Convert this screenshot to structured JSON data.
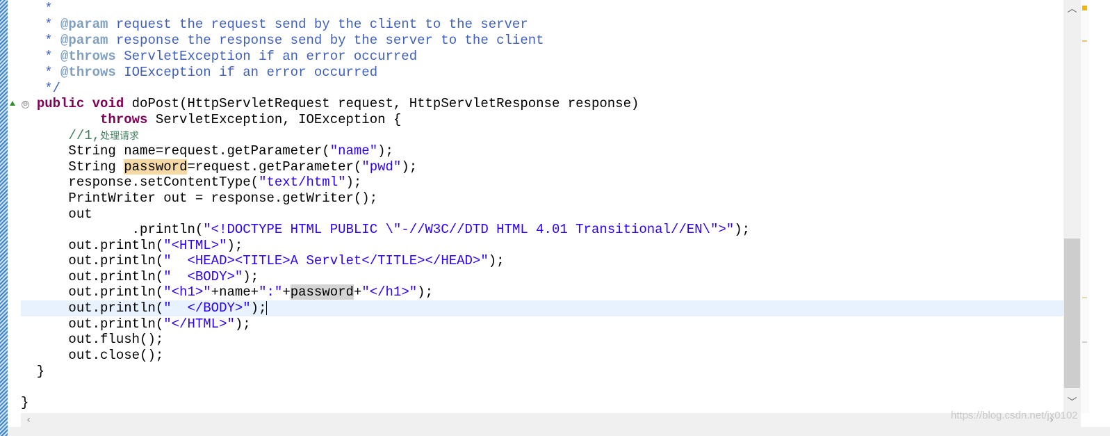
{
  "editor": {
    "lines": {
      "l1": {
        "text": "   *"
      },
      "l2": {
        "pre": "   * ",
        "tag": "@param",
        "post": " request the request send by the client to the server"
      },
      "l3": {
        "pre": "   * ",
        "tag": "@param",
        "post": " response the response send by the server to the client"
      },
      "l4": {
        "pre": "   * ",
        "tag": "@throws",
        "post": " ServletException if an error occurred"
      },
      "l5": {
        "pre": "   * ",
        "tag": "@throws",
        "post": " IOException if an error occurred"
      },
      "l6": {
        "text": "   */"
      },
      "l7": {
        "indent": "  ",
        "kw1": "public",
        "sp1": " ",
        "kw2": "void",
        "rest": " doPost(HttpServletRequest request, HttpServletResponse response)"
      },
      "l8": {
        "indent": "          ",
        "kw": "throws",
        "rest": " ServletException, IOException {"
      },
      "l9": {
        "indent": "      ",
        "prefix": "//1,",
        "cjk": "处理请求"
      },
      "l10": {
        "indent": "      ",
        "a": "String name=request.getParameter(",
        "s": "\"name\"",
        "b": ");"
      },
      "l11": {
        "indent": "      ",
        "a": "String ",
        "occ": "password",
        "b": "=request.getParameter(",
        "s": "\"pwd\"",
        "c": ");"
      },
      "l12": {
        "indent": "      ",
        "a": "response.setContentType(",
        "s": "\"text/html\"",
        "b": ");"
      },
      "l13": {
        "indent": "      ",
        "a": "PrintWriter out = response.getWriter();"
      },
      "l14": {
        "indent": "      ",
        "a": "out"
      },
      "l15": {
        "indent": "              ",
        "a": ".println(",
        "s": "\"<!DOCTYPE HTML PUBLIC \\\"-//W3C//DTD HTML 4.01 Transitional//EN\\\">\"",
        "b": ");"
      },
      "l16": {
        "indent": "      ",
        "a": "out.println(",
        "s": "\"<HTML>\"",
        "b": ");"
      },
      "l17": {
        "indent": "      ",
        "a": "out.println(",
        "s": "\"  <HEAD><TITLE>A Servlet</TITLE></HEAD>\"",
        "b": ");"
      },
      "l18": {
        "indent": "      ",
        "a": "out.println(",
        "s": "\"  <BODY>\"",
        "b": ");"
      },
      "l19": {
        "indent": "      ",
        "a": "out.println(",
        "s1": "\"<h1>\"",
        "b": "+name+",
        "s2": "\":\"",
        "c": "+",
        "occ": "password",
        "d": "+",
        "s3": "\"</h1>\"",
        "e": ");"
      },
      "l20": {
        "indent": "      ",
        "a": "out.println(",
        "s": "\"  </BODY>\"",
        "b": ");"
      },
      "l21": {
        "indent": "      ",
        "a": "out.println(",
        "s": "\"</HTML>\"",
        "b": ");"
      },
      "l22": {
        "indent": "      ",
        "a": "out.flush();"
      },
      "l23": {
        "indent": "      ",
        "a": "out.close();"
      },
      "l24": {
        "text": "  }"
      },
      "l25": {
        "text": ""
      },
      "l26": {
        "text": "}"
      }
    }
  },
  "gutter": {
    "fold_glyph": "⊖"
  },
  "scrollbars": {
    "up": "︿",
    "down": "﹀",
    "left": "‹",
    "right": "›"
  },
  "watermark": "https://blog.csdn.net/jx0102"
}
